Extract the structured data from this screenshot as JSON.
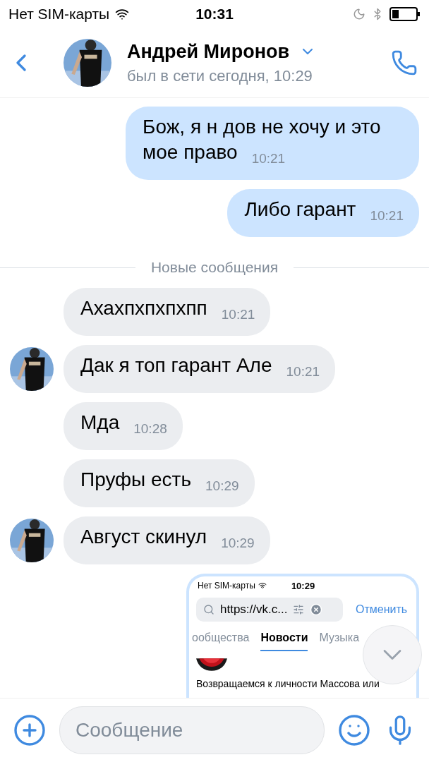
{
  "status_bar": {
    "carrier": "Нет SIM-карты",
    "time": "10:31"
  },
  "header": {
    "name": "Андрей Миронов",
    "status": "был в сети сегодня, 10:29"
  },
  "items": [
    {
      "kind": "message",
      "outgoing": true,
      "text": "Бож, я н дов не хочу и это мое право",
      "time": "10:21"
    },
    {
      "kind": "message",
      "outgoing": true,
      "text": "Либо гарант",
      "time": "10:21"
    },
    {
      "kind": "divider",
      "text": "Новые сообщения"
    },
    {
      "kind": "message",
      "outgoing": false,
      "text": "Ахахпхпхпхпп",
      "time": "10:21",
      "avatar": false
    },
    {
      "kind": "message",
      "outgoing": false,
      "text": "Дак я топ гарант Але",
      "time": "10:21",
      "avatar": true
    },
    {
      "kind": "message",
      "outgoing": false,
      "text": "Мда",
      "time": "10:28",
      "avatar": false
    },
    {
      "kind": "message",
      "outgoing": false,
      "text": "Пруфы есть",
      "time": "10:29",
      "avatar": false
    },
    {
      "kind": "message",
      "outgoing": false,
      "text": "Август скинул",
      "time": "10:29",
      "avatar": true
    },
    {
      "kind": "screenshot",
      "status_bar": {
        "carrier": "Нет SIM-карты",
        "time": "10:29"
      },
      "search": {
        "value": "https://vk.c...",
        "cancel": "Отменить"
      },
      "tabs": [
        {
          "label": "ообщества",
          "selected": false
        },
        {
          "label": "Новости",
          "selected": true
        },
        {
          "label": "Музыка",
          "selected": false
        }
      ],
      "post_text": "Возвращаемся к личности Массова или"
    }
  ],
  "composer": {
    "placeholder": "Сообщение"
  }
}
